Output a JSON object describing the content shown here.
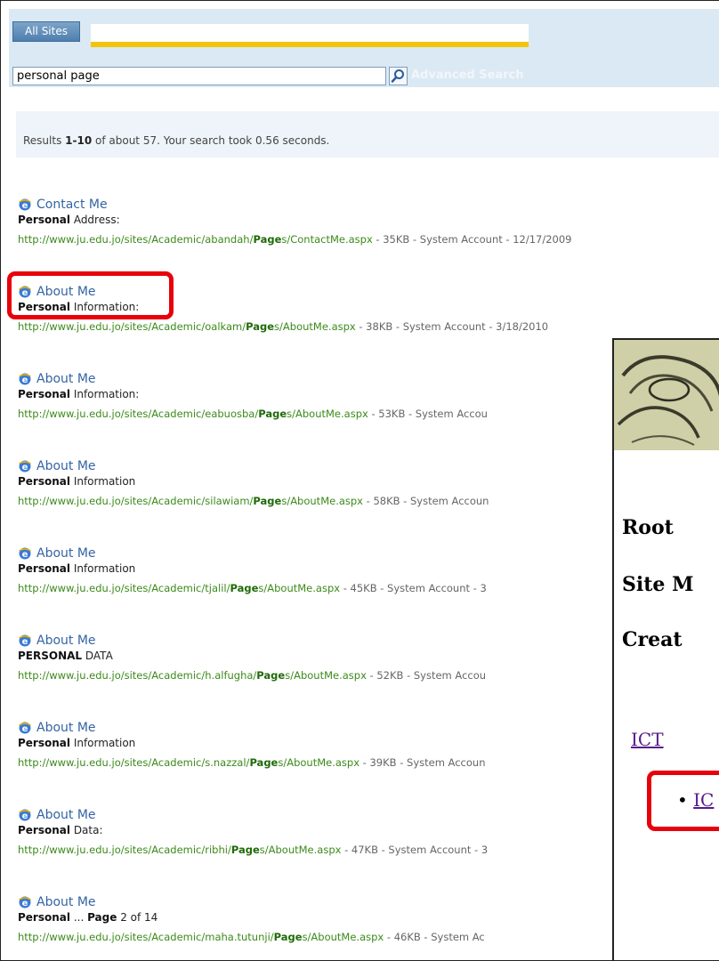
{
  "search": {
    "scope_tab": "All Sites",
    "query": "personal page",
    "advanced_search": "Advanced Search"
  },
  "summary": {
    "prefix": "Results ",
    "range": "1-10",
    "suffix": " of about 57. Your search took 0.56 seconds."
  },
  "results": [
    {
      "title": "Contact Me",
      "desc_bold": "Personal",
      "desc_rest": " Address:",
      "url_pre": "http://www.ju.edu.jo/sites/Academic/abandah/",
      "url_bold": "Page",
      "url_post": "s/ContactMe.aspx",
      "meta": " - 35KB - System Account - 12/17/2009"
    },
    {
      "title": "About Me",
      "desc_bold": "Personal",
      "desc_rest": " Information:",
      "url_pre": "http://www.ju.edu.jo/sites/Academic/oalkam/",
      "url_bold": "Page",
      "url_post": "s/AboutMe.aspx",
      "meta": " - 38KB - System Account - 3/18/2010"
    },
    {
      "title": "About Me",
      "desc_bold": "Personal",
      "desc_rest": " Information:",
      "url_pre": "http://www.ju.edu.jo/sites/Academic/eabuosba/",
      "url_bold": "Page",
      "url_post": "s/AboutMe.aspx",
      "meta": " - 53KB - System Accou"
    },
    {
      "title": "About Me",
      "desc_bold": "Personal",
      "desc_rest": " Information",
      "url_pre": "http://www.ju.edu.jo/sites/Academic/silawiam/",
      "url_bold": "Page",
      "url_post": "s/AboutMe.aspx",
      "meta": " - 58KB - System Accoun"
    },
    {
      "title": "About Me",
      "desc_bold": "Personal",
      "desc_rest": " Information",
      "url_pre": "http://www.ju.edu.jo/sites/Academic/tjalil/",
      "url_bold": "Page",
      "url_post": "s/AboutMe.aspx",
      "meta": " - 45KB - System Account - 3"
    },
    {
      "title": "About Me",
      "desc_bold": "PERSONAL",
      "desc_rest": " DATA",
      "url_pre": "http://www.ju.edu.jo/sites/Academic/h.alfugha/",
      "url_bold": "Page",
      "url_post": "s/AboutMe.aspx",
      "meta": " - 52KB - System Accou"
    },
    {
      "title": "About Me",
      "desc_bold": "Personal",
      "desc_rest": " Information",
      "url_pre": "http://www.ju.edu.jo/sites/Academic/s.nazzal/",
      "url_bold": "Page",
      "url_post": "s/AboutMe.aspx",
      "meta": " - 39KB - System Accoun"
    },
    {
      "title": "About Me",
      "desc_bold": "Personal",
      "desc_rest": " Data:",
      "url_pre": "http://www.ju.edu.jo/sites/Academic/ribhi/",
      "url_bold": "Page",
      "url_post": "s/AboutMe.aspx",
      "meta": " - 47KB - System Account - 3"
    },
    {
      "title": "About Me",
      "desc_bold": "Personal",
      "desc_rest": " ... ",
      "desc_bold2": "Page",
      "desc_rest2": " 2 of 14",
      "url_pre": "http://www.ju.edu.jo/sites/Academic/maha.tutunji/",
      "url_bold": "Page",
      "url_post": "s/AboutMe.aspx",
      "meta": " - 46KB - System Ac"
    }
  ],
  "overlay": {
    "heading1": "Root",
    "heading2": "Site M",
    "heading3": "Creat",
    "link": "ICT",
    "bullet_link": "IC"
  },
  "colors": {
    "highlight": "#e8000a",
    "scope_bar": "#f2c40d",
    "url_green": "#3c8a1a",
    "link_blue": "#3464a4"
  }
}
